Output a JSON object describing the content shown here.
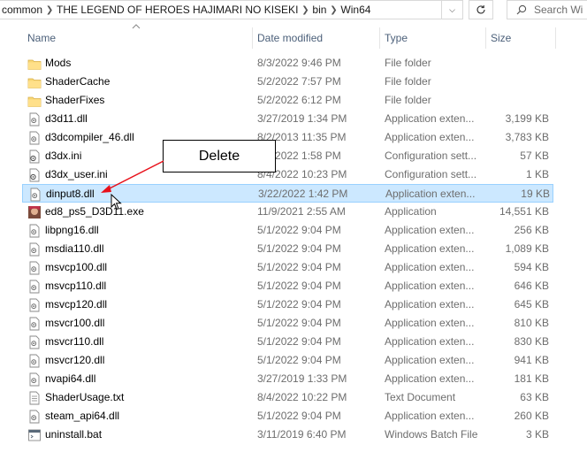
{
  "address": {
    "crumbs": [
      "common",
      "THE LEGEND OF HEROES HAJIMARI NO KISEKI",
      "bin",
      "Win64"
    ],
    "search_placeholder": "Search Wi"
  },
  "columns": {
    "name": "Name",
    "date": "Date modified",
    "type": "Type",
    "size": "Size"
  },
  "files": [
    {
      "name": "Mods",
      "date": "8/3/2022 9:46 PM",
      "type": "File folder",
      "size": "",
      "icon": "folder-icon"
    },
    {
      "name": "ShaderCache",
      "date": "5/2/2022 7:57 PM",
      "type": "File folder",
      "size": "",
      "icon": "folder-icon"
    },
    {
      "name": "ShaderFixes",
      "date": "5/2/2022 6:12 PM",
      "type": "File folder",
      "size": "",
      "icon": "folder-icon"
    },
    {
      "name": "d3d11.dll",
      "date": "3/27/2019 1:34 PM",
      "type": "Application exten...",
      "size": "3,199 KB",
      "icon": "dll-file-icon"
    },
    {
      "name": "d3dcompiler_46.dll",
      "date": "8/2/2013 11:35 PM",
      "type": "Application exten...",
      "size": "3,783 KB",
      "icon": "dll-file-icon"
    },
    {
      "name": "d3dx.ini",
      "date": "8/4/2022 1:58 PM",
      "type": "Configuration sett...",
      "size": "57 KB",
      "icon": "config-file-icon"
    },
    {
      "name": "d3dx_user.ini",
      "date": "8/4/2022 10:23 PM",
      "type": "Configuration sett...",
      "size": "1 KB",
      "icon": "config-file-icon"
    },
    {
      "name": "dinput8.dll",
      "date": "3/22/2022 1:42 PM",
      "type": "Application exten...",
      "size": "19 KB",
      "icon": "dll-file-icon",
      "selected": true
    },
    {
      "name": "ed8_ps5_D3D11.exe",
      "date": "11/9/2021 2:55 AM",
      "type": "Application",
      "size": "14,551 KB",
      "icon": "app-exe-icon"
    },
    {
      "name": "libpng16.dll",
      "date": "5/1/2022 9:04 PM",
      "type": "Application exten...",
      "size": "256 KB",
      "icon": "dll-file-icon"
    },
    {
      "name": "msdia110.dll",
      "date": "5/1/2022 9:04 PM",
      "type": "Application exten...",
      "size": "1,089 KB",
      "icon": "dll-file-icon"
    },
    {
      "name": "msvcp100.dll",
      "date": "5/1/2022 9:04 PM",
      "type": "Application exten...",
      "size": "594 KB",
      "icon": "dll-file-icon"
    },
    {
      "name": "msvcp110.dll",
      "date": "5/1/2022 9:04 PM",
      "type": "Application exten...",
      "size": "646 KB",
      "icon": "dll-file-icon"
    },
    {
      "name": "msvcp120.dll",
      "date": "5/1/2022 9:04 PM",
      "type": "Application exten...",
      "size": "645 KB",
      "icon": "dll-file-icon"
    },
    {
      "name": "msvcr100.dll",
      "date": "5/1/2022 9:04 PM",
      "type": "Application exten...",
      "size": "810 KB",
      "icon": "dll-file-icon"
    },
    {
      "name": "msvcr110.dll",
      "date": "5/1/2022 9:04 PM",
      "type": "Application exten...",
      "size": "830 KB",
      "icon": "dll-file-icon"
    },
    {
      "name": "msvcr120.dll",
      "date": "5/1/2022 9:04 PM",
      "type": "Application exten...",
      "size": "941 KB",
      "icon": "dll-file-icon"
    },
    {
      "name": "nvapi64.dll",
      "date": "3/27/2019 1:33 PM",
      "type": "Application exten...",
      "size": "181 KB",
      "icon": "dll-file-icon"
    },
    {
      "name": "ShaderUsage.txt",
      "date": "8/4/2022 10:22 PM",
      "type": "Text Document",
      "size": "63 KB",
      "icon": "text-file-icon"
    },
    {
      "name": "steam_api64.dll",
      "date": "5/1/2022 9:04 PM",
      "type": "Application exten...",
      "size": "260 KB",
      "icon": "dll-file-icon"
    },
    {
      "name": "uninstall.bat",
      "date": "3/11/2019 6:40 PM",
      "type": "Windows Batch File",
      "size": "3 KB",
      "icon": "batch-file-icon"
    }
  ],
  "annotation": {
    "label": "Delete"
  },
  "colors": {
    "selection_bg": "#cce8ff",
    "selection_border": "#99d1ff",
    "arrow": "#e8101a",
    "folder": "#f8d775",
    "header_text": "#4c607a"
  }
}
